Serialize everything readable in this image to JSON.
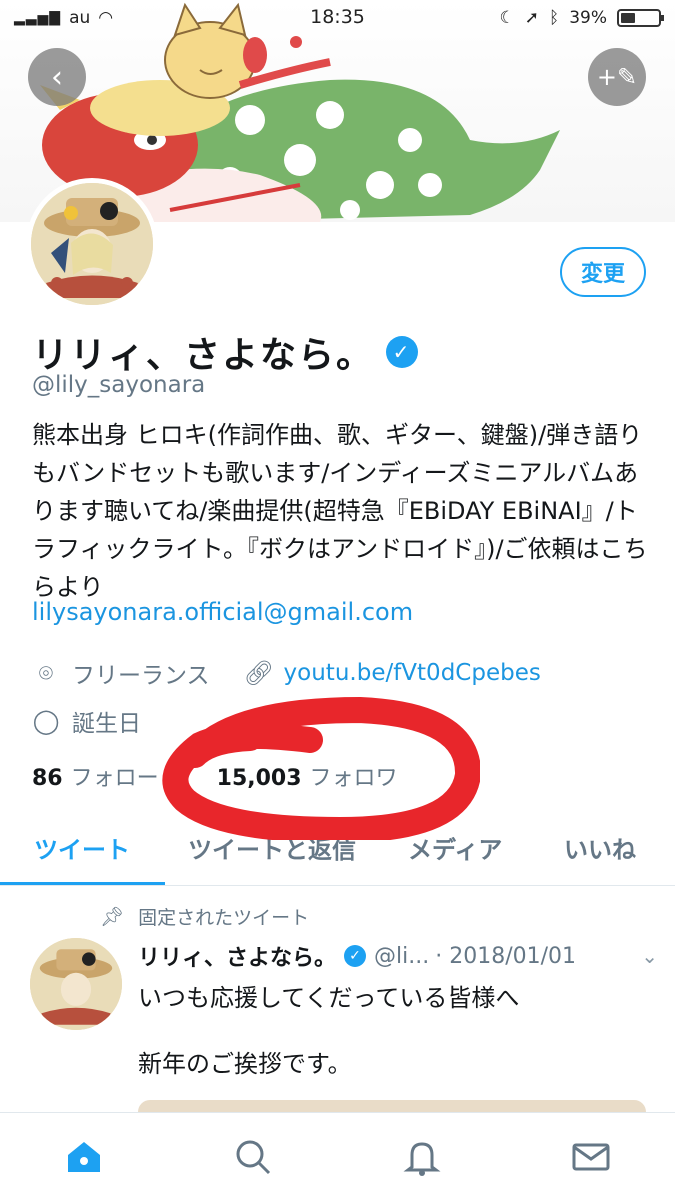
{
  "status_bar": {
    "carrier": "au",
    "time": "18:35",
    "battery": "39%"
  },
  "header": {
    "back_icon": "chevron-left-icon",
    "compose_icon": "compose-tweet-icon"
  },
  "profile": {
    "edit_label": "変更",
    "name": "リリィ、さよなら。",
    "handle": "@lily_sayonara",
    "bio": "熊本出身 ヒロキ(作詞作曲、歌、ギター、鍵盤)/弾き語りもバンドセットも歌います/インディーズミニアルバムあります聴いてね/楽曲提供(超特急『EBiDAY EBiNAI』/トラフィックライト。『ボクはアンドロイド』)/ご依頼はこちらより",
    "bio_email": "lilysayonara.official@gmail.com",
    "location": "フリーランス",
    "website": "youtu.be/fVt0dCpebes",
    "birthday_label": "誕生日",
    "following_count": "86",
    "following_label": "フォロー",
    "followers_count": "15,003",
    "followers_label": "フォロワ"
  },
  "tabs": [
    {
      "label": "ツイート"
    },
    {
      "label": "ツイートと返信"
    },
    {
      "label": "メディア"
    },
    {
      "label": "いいね"
    }
  ],
  "pinned_tweet": {
    "pinned_label": "固定されたツイート",
    "name": "リリィ、さよなら。",
    "handle": "@li...",
    "date": "· 2018/01/01",
    "line1": "いつも応援してくだっている皆様へ",
    "line2": "新年のご挨拶です。"
  },
  "colors": {
    "accent": "#1da1f2",
    "link": "#1b95e0",
    "secondary_text": "#657786",
    "annotation": "#e8262b"
  }
}
